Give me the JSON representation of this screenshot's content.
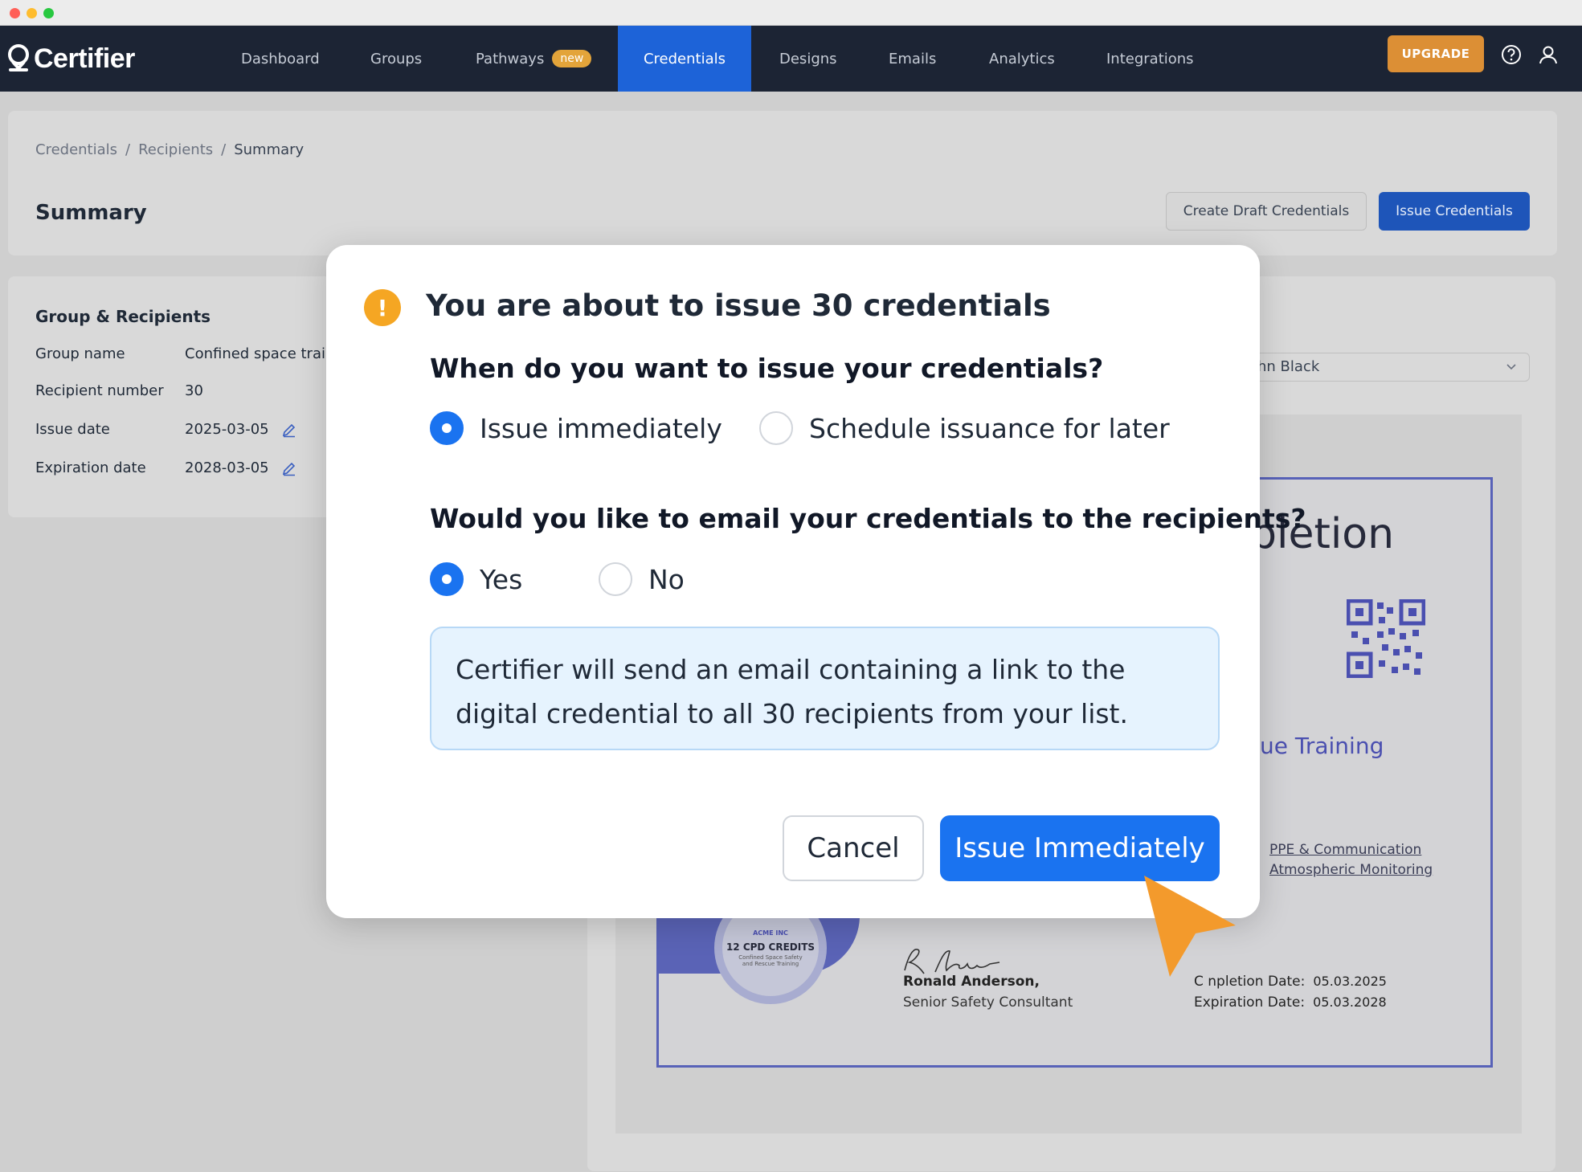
{
  "nav": {
    "logo": "Certifier",
    "items": [
      {
        "label": "Dashboard"
      },
      {
        "label": "Groups"
      },
      {
        "label": "Pathways",
        "badge": "new"
      },
      {
        "label": "Credentials"
      },
      {
        "label": "Designs"
      },
      {
        "label": "Emails"
      },
      {
        "label": "Analytics"
      },
      {
        "label": "Integrations"
      }
    ],
    "active": "Credentials",
    "upgrade_label": "UPGRADE",
    "help_icon": "help-circle-icon",
    "user_icon": "user-icon"
  },
  "breadcrumb": [
    "Credentials",
    "Recipients",
    "Summary"
  ],
  "page": {
    "title": "Summary",
    "create_draft_label": "Create Draft Credentials",
    "issue_label": "Issue Credentials"
  },
  "group": {
    "title": "Group & Recipients",
    "rows": [
      {
        "label": "Group name",
        "value": "Confined space traini"
      },
      {
        "label": "Recipient number",
        "value": "30"
      },
      {
        "label": "Issue date",
        "value": "2025-03-05"
      },
      {
        "label": "Expiration date",
        "value": "2028-03-05"
      }
    ]
  },
  "preview": {
    "recipient_select": "hn Black",
    "cert_title": "pletion",
    "course": "ue Training",
    "links": [
      "PPE & Communication",
      "Atmospheric Monitoring"
    ],
    "signer_name": "Ronald Anderson,",
    "signer_role": "Senior Safety Consultant",
    "completion_label": "C  npletion Date:",
    "completion_value": "05.03.2025",
    "expiration_label": "Expiration Date:",
    "expiration_value": "05.03.2028",
    "seal_org": "ACME INC",
    "seal_cpd": "12 CPD CREDITS",
    "seal_sub": "Confined Space Safety and Rescue Training"
  },
  "modal": {
    "title": "You are about to issue 30 credentials",
    "q1": "When do you want to issue your credentials?",
    "q1_options": [
      "Issue immediately",
      "Schedule issuance for later"
    ],
    "q1_selected": "Issue immediately",
    "q2": "Would you like to email your credentials to the recipients?",
    "q2_options": [
      "Yes",
      "No"
    ],
    "q2_selected": "Yes",
    "info": "Certifier will send an email containing a link to the digital credential to all 30 recipients from your list.",
    "cancel_label": "Cancel",
    "confirm_label": "Issue Immediately"
  },
  "colors": {
    "nav_bg": "#1c2434",
    "accent": "#1a73f0",
    "upgrade": "#dc8f35",
    "warning": "#f5a623",
    "cursor": "#f39a2c"
  }
}
